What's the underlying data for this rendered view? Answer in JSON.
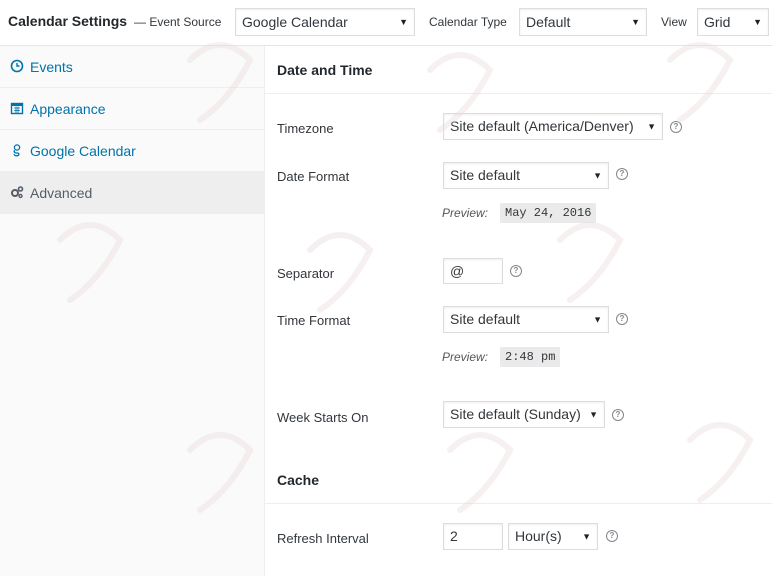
{
  "header": {
    "title": "Calendar Settings",
    "event_source_label": "— Event Source",
    "event_source_value": "Google Calendar",
    "calendar_type_label": "Calendar Type",
    "calendar_type_value": "Default",
    "view_label": "View",
    "view_value": "Grid"
  },
  "sidebar": {
    "items": [
      {
        "label": "Events",
        "icon": "clock-icon"
      },
      {
        "label": "Appearance",
        "icon": "calendar-icon"
      },
      {
        "label": "Google Calendar",
        "icon": "google-icon"
      },
      {
        "label": "Advanced",
        "icon": "gears-icon",
        "active": true
      }
    ]
  },
  "date_time": {
    "heading": "Date and Time",
    "timezone": {
      "label": "Timezone",
      "value": "Site default (America/Denver)"
    },
    "date_format": {
      "label": "Date Format",
      "value": "Site default",
      "preview_label": "Preview:",
      "preview": "May 24, 2016"
    },
    "separator": {
      "label": "Separator",
      "value": "@"
    },
    "time_format": {
      "label": "Time Format",
      "value": "Site default",
      "preview_label": "Preview:",
      "preview": "2:48 pm"
    },
    "week_start": {
      "label": "Week Starts On",
      "value": "Site default (Sunday)"
    }
  },
  "cache": {
    "heading": "Cache",
    "refresh": {
      "label": "Refresh Interval",
      "value": "2",
      "unit": "Hour(s)"
    }
  },
  "colors": {
    "link": "#0073aa",
    "border": "#dddddd",
    "active_bg": "#eeeeee"
  },
  "help_glyph": "?"
}
